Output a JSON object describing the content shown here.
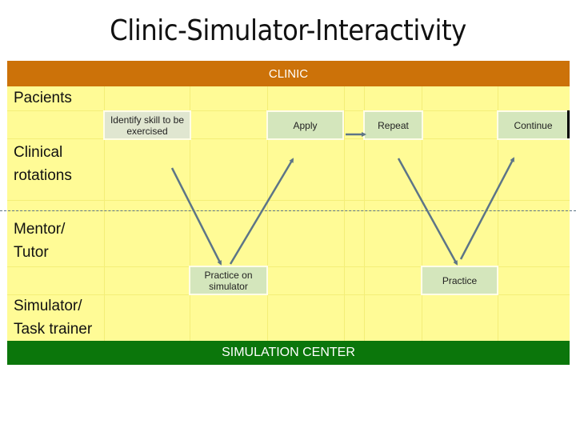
{
  "title": "Clinic-Simulator-Interactivity",
  "bands": {
    "top": "CLINIC",
    "bottom": "SIMULATION CENTER"
  },
  "row_labels": {
    "pacients": "Pacients",
    "clinical_1": "Clinical",
    "clinical_2": "rotations",
    "mentor_1": "Mentor/",
    "mentor_2": "Tutor",
    "simulator_1": "Simulator/",
    "simulator_2": "Task trainer"
  },
  "steps": {
    "identify_1": "Identify skill to be",
    "identify_2": "exercised",
    "apply": "Apply",
    "repeat": "Repeat",
    "continue": "Continue",
    "practice_sim_1": "Practice on",
    "practice_sim_2": "simulator",
    "practice": "Practice"
  },
  "colors": {
    "clinic_band": "#cc7209",
    "simulation_band": "#0b760b",
    "grid_fill": "#fffb96",
    "step_box": "#d4e6bc",
    "arrow": "#5d7587"
  },
  "flow": [
    {
      "from": "Identify skill to be exercised",
      "to": "Practice on simulator"
    },
    {
      "from": "Practice on simulator",
      "to": "Apply"
    },
    {
      "from": "Apply",
      "to": "Repeat"
    },
    {
      "from": "Repeat",
      "to": "Practice"
    },
    {
      "from": "Practice",
      "to": "Continue"
    }
  ]
}
